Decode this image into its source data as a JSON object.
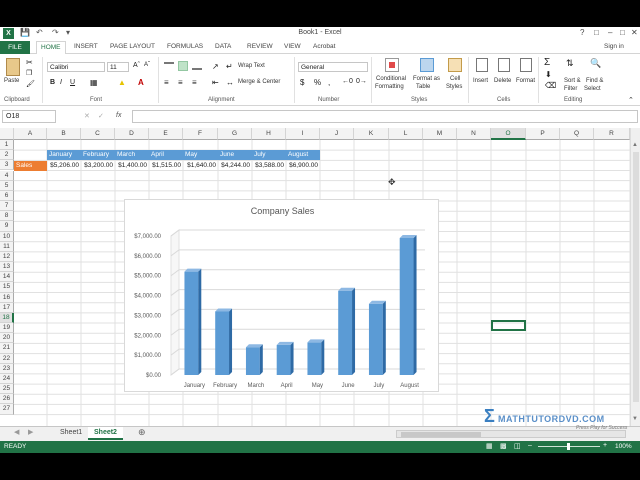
{
  "window": {
    "title": "Book1 - Excel",
    "app_icon": "X",
    "account": "Sign in"
  },
  "ribbon_tabs": [
    "FILE",
    "HOME",
    "INSERT",
    "PAGE LAYOUT",
    "FORMULAS",
    "DATA",
    "REVIEW",
    "VIEW",
    "Acrobat"
  ],
  "ribbon": {
    "clipboard": {
      "paste": "Paste",
      "label": "Clipboard"
    },
    "font": {
      "name": "Calibri",
      "size": "11",
      "bold": "B",
      "italic": "I",
      "underline": "U",
      "label": "Font"
    },
    "alignment": {
      "wrap": "Wrap Text",
      "merge": "Merge & Center",
      "label": "Alignment"
    },
    "number": {
      "format": "General",
      "currency": "$",
      "percent": "%",
      "comma": ",",
      "label": "Number"
    },
    "styles": {
      "cond1": "Conditional",
      "cond2": "Formatting",
      "fmt1": "Format as",
      "fmt2": "Table",
      "cell1": "Cell",
      "cell2": "Styles",
      "label": "Styles"
    },
    "cells": {
      "insert": "Insert",
      "delete": "Delete",
      "format": "Format",
      "label": "Cells"
    },
    "editing": {
      "sort1": "Sort &",
      "sort2": "Filter",
      "find1": "Find &",
      "find2": "Select",
      "label": "Editing"
    }
  },
  "formula_bar": {
    "name_box": "O18",
    "fx": "fx",
    "content": ""
  },
  "columns": [
    "A",
    "B",
    "C",
    "D",
    "E",
    "F",
    "G",
    "H",
    "I",
    "J",
    "K",
    "L",
    "M",
    "N",
    "O",
    "P",
    "Q",
    "R"
  ],
  "selected_column": "O",
  "selected_row": 18,
  "rows_visible": 27,
  "sheet": {
    "row2": [
      "January",
      "February",
      "March",
      "April",
      "May",
      "June",
      "July",
      "August"
    ],
    "row3_label": "Sales",
    "row3": [
      "$5,206.00",
      "$3,200.00",
      "$1,400.00",
      "$1,515.00",
      "$1,640.00",
      "$4,244.00",
      "$3,588.00",
      "$6,900.00"
    ]
  },
  "chart_data": {
    "type": "bar",
    "title": "Company Sales",
    "categories": [
      "January",
      "February",
      "March",
      "April",
      "May",
      "June",
      "July",
      "August"
    ],
    "values": [
      5206,
      3200,
      1400,
      1515,
      1640,
      4244,
      3588,
      6900
    ],
    "y_ticks": [
      "$0.00",
      "$1,000.00",
      "$2,000.00",
      "$3,000.00",
      "$4,000.00",
      "$5,000.00",
      "$6,000.00",
      "$7,000.00"
    ],
    "ylim": [
      0,
      7000
    ],
    "grid": true,
    "style": "3d-column",
    "color": "#5b9bd5"
  },
  "sheet_tabs": [
    "Sheet1",
    "Sheet2"
  ],
  "active_sheet": "Sheet2",
  "status": {
    "ready": "READY",
    "zoom": "100%"
  },
  "watermark": {
    "brand": "MATHTUTORDVD.COM",
    "tagline": "Press Play for Success"
  },
  "colors": {
    "excel_green": "#217346",
    "accent_blue": "#5b9bd5",
    "sales_orange": "#ed7d31"
  }
}
